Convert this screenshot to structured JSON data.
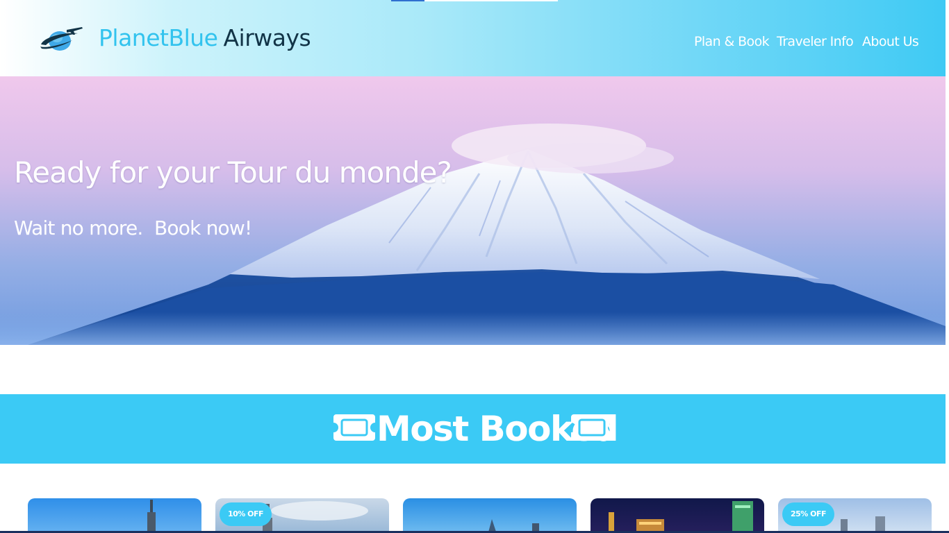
{
  "brand": {
    "name_part1": "PlanetBlue",
    "name_part2": "Airways",
    "logo_icon": "planet-plane-icon"
  },
  "nav": {
    "items": [
      {
        "label": "Plan & Book"
      },
      {
        "label": "Traveler Info"
      },
      {
        "label": "About Us"
      }
    ]
  },
  "hero": {
    "title": "Ready for your Tour du monde?",
    "subtitle": "Wait no more.",
    "cta": "Book now!"
  },
  "most_booked": {
    "title": "Most Booked",
    "icon": "ticket-icon"
  },
  "cards": [
    {
      "badge": ""
    },
    {
      "badge": "10% OFF"
    },
    {
      "badge": ""
    },
    {
      "badge": ""
    },
    {
      "badge": "25% OFF"
    }
  ],
  "colors": {
    "accent": "#3bcaf5",
    "brand_dark": "#123447",
    "hero_deep_blue": "#1e50a0"
  }
}
